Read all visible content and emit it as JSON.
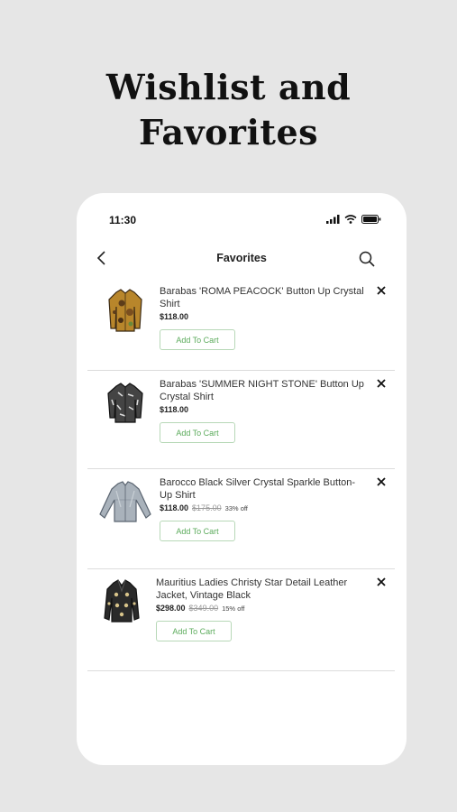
{
  "headline": {
    "line1": "Wishlist and",
    "line2": "Favorites"
  },
  "status_bar": {
    "time": "11:30"
  },
  "header": {
    "title": "Favorites"
  },
  "items": [
    {
      "name": "Barabas 'ROMA PEACOCK' Button Up Crystal Shirt",
      "price": "$118.00",
      "original_price": "",
      "discount": "",
      "button": "Add To Cart"
    },
    {
      "name": "Barabas 'SUMMER NIGHT STONE' Button Up Crystal Shirt",
      "price": "$118.00",
      "original_price": "",
      "discount": "",
      "button": "Add To Cart"
    },
    {
      "name": "Barocco Black Silver Crystal Sparkle Button-Up Shirt",
      "price": "$118.00",
      "original_price": "$175.00",
      "discount": "33% off",
      "button": "Add To Cart"
    },
    {
      "name": "Mauritius Ladies Christy Star Detail Leather Jacket, Vintage Black",
      "price": "$298.00",
      "original_price": "$349.00",
      "discount": "15% off",
      "button": "Add To Cart"
    }
  ],
  "colors": {
    "background": "#e6e6e6",
    "accent_green": "#5cab5c"
  }
}
